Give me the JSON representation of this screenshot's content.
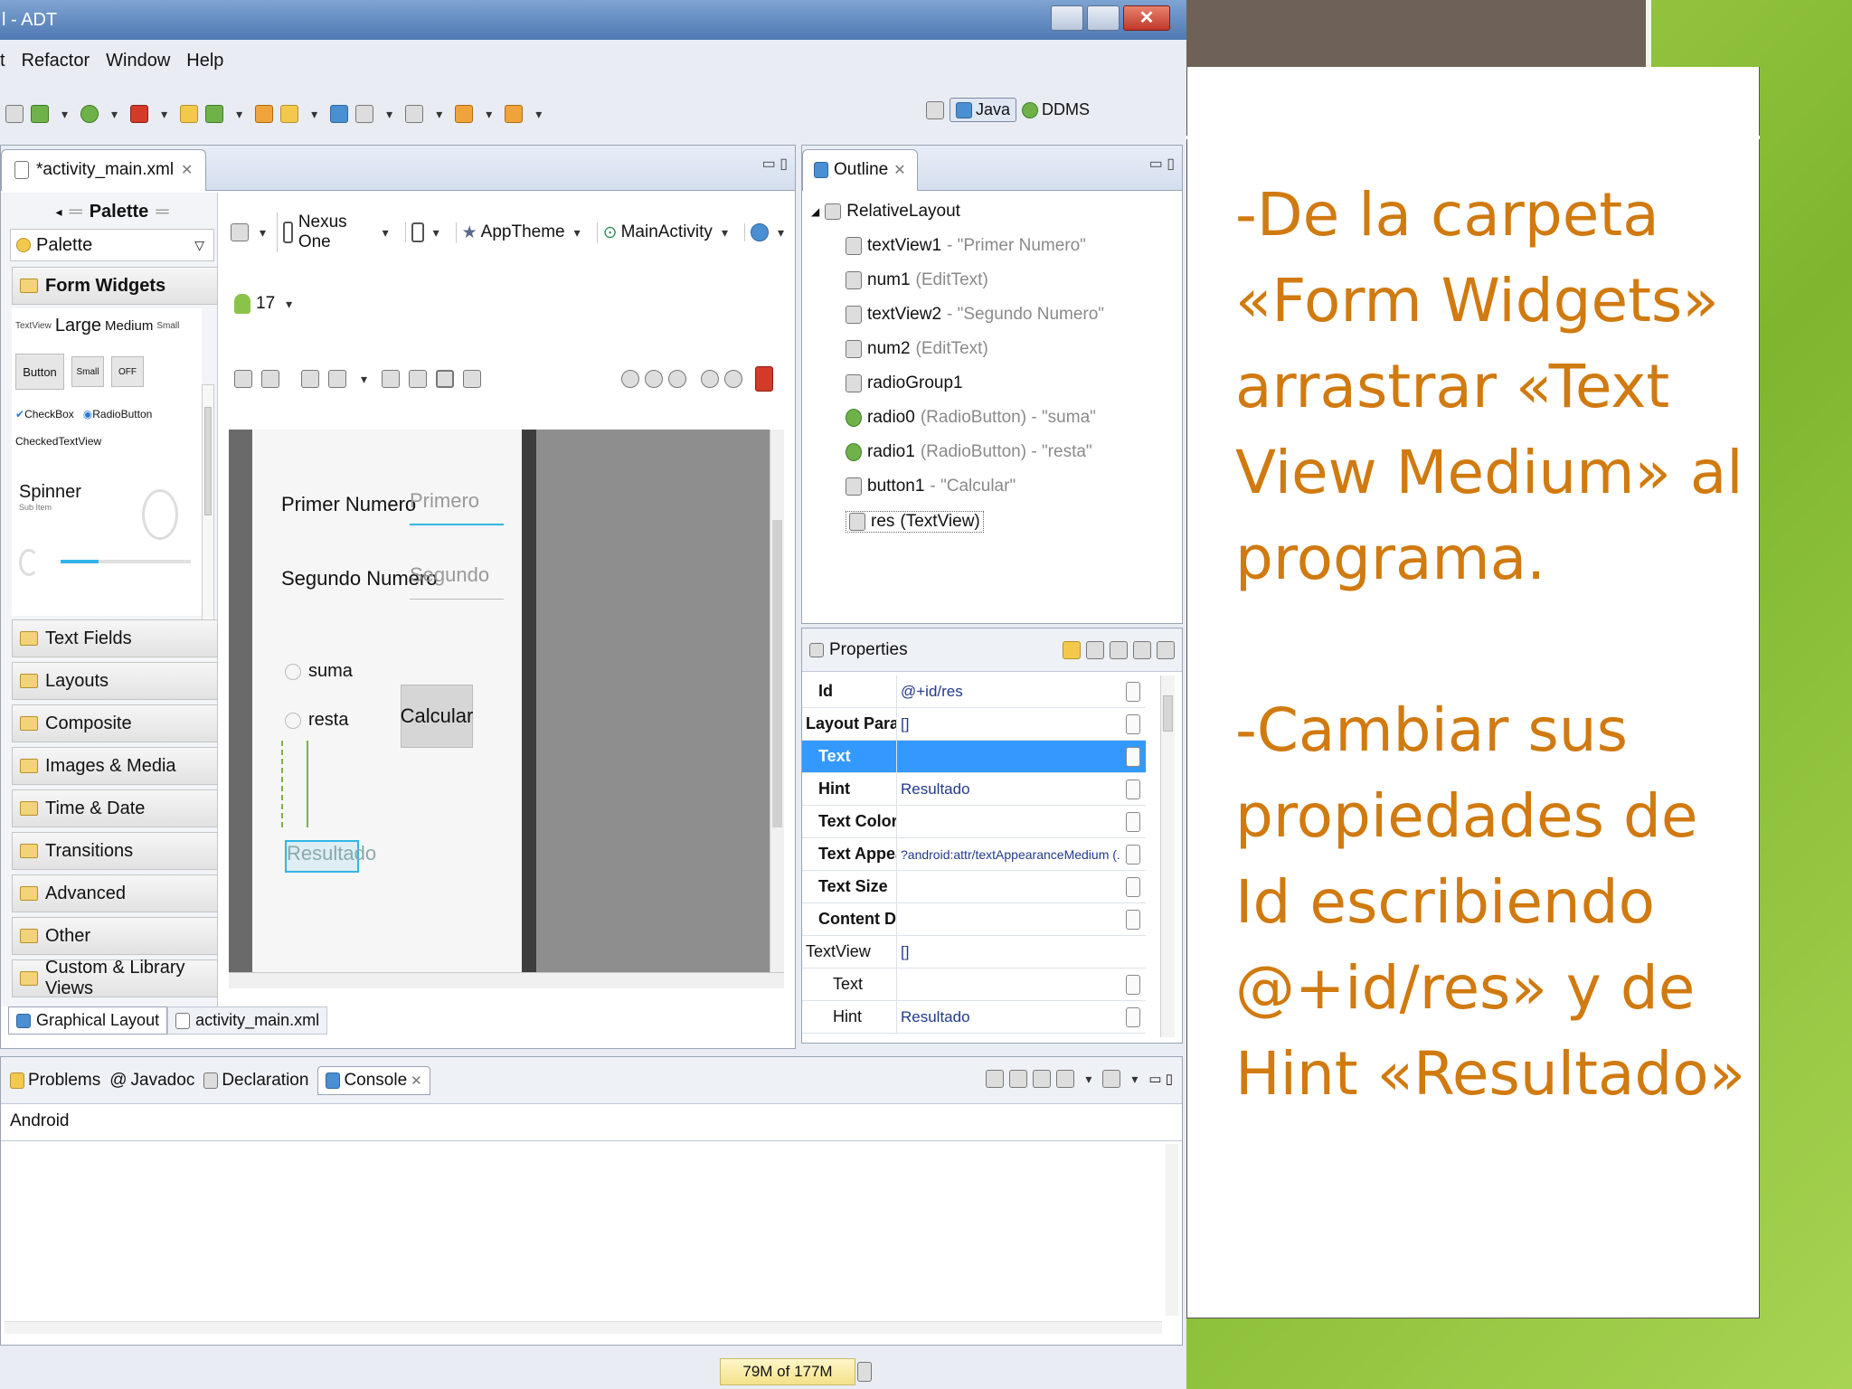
{
  "window": {
    "title": "l - ADT"
  },
  "menu": [
    "t",
    "Refactor",
    "Window",
    "Help"
  ],
  "perspectives": {
    "java": "Java",
    "ddms": "DDMS"
  },
  "editor": {
    "tab": "*activity_main.xml",
    "device": "Nexus One",
    "theme": "AppTheme",
    "activity": "MainActivity",
    "api": "17",
    "bottom_tabs": [
      "Graphical Layout",
      "activity_main.xml"
    ]
  },
  "palette": {
    "title": "Palette",
    "dropdown": "Palette",
    "open_section": "Form Widgets",
    "text_sizes": {
      "tiny": "TextView",
      "large": "Large",
      "medium": "Medium",
      "small": "Small"
    },
    "buttons": {
      "button": "Button",
      "small": "Small",
      "off": "OFF"
    },
    "checkbox": "CheckBox",
    "radiobutton": "RadioButton",
    "checked_text": "CheckedTextView",
    "spinner": "Spinner",
    "spinner_sub": "Sub Item",
    "sections": [
      "Text Fields",
      "Layouts",
      "Composite",
      "Images & Media",
      "Time & Date",
      "Transitions",
      "Advanced",
      "Other",
      "Custom & Library Views"
    ]
  },
  "canvas": {
    "label1": "Primer Numero",
    "hint1": "Primero",
    "label2": "Segundo Numero",
    "hint2": "Segundo",
    "radio1": "suma",
    "radio2": "resta",
    "button": "Calcular",
    "result_hint": "Resultado"
  },
  "outline": {
    "title": "Outline",
    "root": "RelativeLayout",
    "items": [
      {
        "id": "textView1",
        "info": " - \"Primer Numero\""
      },
      {
        "id": "num1",
        "info": " (EditText)"
      },
      {
        "id": "textView2",
        "info": " - \"Segundo Numero\""
      },
      {
        "id": "num2",
        "info": " (EditText)"
      },
      {
        "id": "radioGroup1",
        "info": ""
      },
      {
        "id": "radio0",
        "info": " (RadioButton) - \"suma\""
      },
      {
        "id": "radio1",
        "info": " (RadioButton) - \"resta\""
      },
      {
        "id": "button1",
        "info": " - \"Calcular\""
      },
      {
        "id": "res",
        "info": " (TextView)"
      }
    ]
  },
  "properties": {
    "title": "Properties",
    "rows": [
      {
        "key": "Id",
        "value": "@+id/res"
      },
      {
        "key": "Layout Para...",
        "value": "[]"
      },
      {
        "key": "Text",
        "value": ""
      },
      {
        "key": "Hint",
        "value": "Resultado"
      },
      {
        "key": "Text Color",
        "value": ""
      },
      {
        "key": "Text Appea...",
        "value": "?android:attr/textAppearanceMedium (..."
      },
      {
        "key": "Text Size",
        "value": ""
      },
      {
        "key": "Content De...",
        "value": ""
      },
      {
        "key": "TextView",
        "value": "[]"
      },
      {
        "key": "Text",
        "value": ""
      },
      {
        "key": "Hint",
        "value": "Resultado"
      }
    ]
  },
  "console": {
    "tabs": [
      "Problems",
      "Javadoc",
      "Declaration",
      "Console"
    ],
    "label": "Android"
  },
  "status": {
    "memory": "79M of 177M"
  },
  "slide": {
    "lines": [
      "-De la carpeta",
      "«Form Widgets»",
      "arrastrar «Text",
      "View Medium» al",
      "programa.",
      "",
      "-Cambiar sus",
      "propiedades de",
      "Id escribiendo",
      "@+id/res» y de",
      "Hint «Resultado»"
    ]
  },
  "colors": {
    "slide_text": "#d07a10",
    "slide_green": "#8fc23a",
    "selection": "#3399ff",
    "slide_brown": "#6e6258"
  }
}
